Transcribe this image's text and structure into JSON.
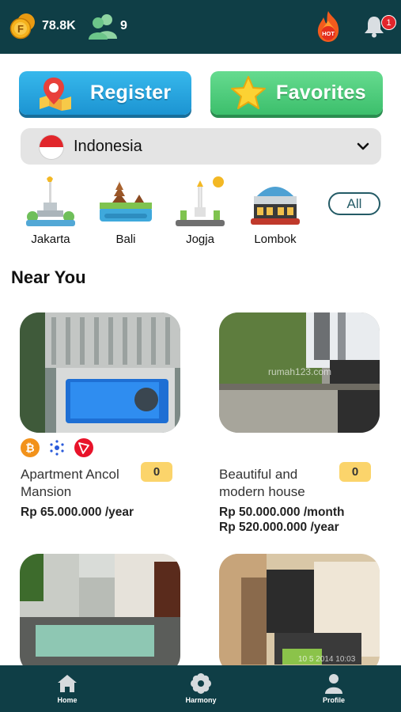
{
  "topbar": {
    "coin_count": "78.8K",
    "friends_count": "9",
    "hot_label": "HOT",
    "notification_badge": "1",
    "coin_label": "F"
  },
  "actions": {
    "register_label": "Register",
    "favorites_label": "Favorites"
  },
  "country": {
    "selected": "Indonesia"
  },
  "cities": [
    {
      "label": "Jakarta"
    },
    {
      "label": "Bali"
    },
    {
      "label": "Jogja"
    },
    {
      "label": "Lombok"
    }
  ],
  "all_label": "All",
  "section": {
    "title": "Near You"
  },
  "properties": [
    {
      "name": "Apartment Ancol Mansion",
      "count": "0",
      "prices": [
        "Rp 65.000.000 /year"
      ],
      "crypto": [
        "bitcoin-icon",
        "cardano-icon",
        "tron-icon"
      ],
      "watermark": ""
    },
    {
      "name": "Beautiful and modern house",
      "count": "0",
      "prices": [
        "Rp 50.000.000 /month",
        "Rp 520.000.000 /year"
      ],
      "crypto": [],
      "watermark": "rumah123.com"
    },
    {
      "name": "",
      "count": "",
      "prices": [],
      "crypto": [],
      "watermark": ""
    },
    {
      "name": "",
      "count": "",
      "prices": [],
      "crypto": [],
      "watermark": "10 5 2014 10:03"
    }
  ],
  "nav": {
    "home": "Home",
    "harmony": "Harmony",
    "profile": "Profile"
  },
  "colors": {
    "bar": "#0f3e46",
    "register": "#1c94d2",
    "favorites": "#3cbf6c",
    "badge": "#e2252b",
    "count_bg": "#fbd46b"
  }
}
